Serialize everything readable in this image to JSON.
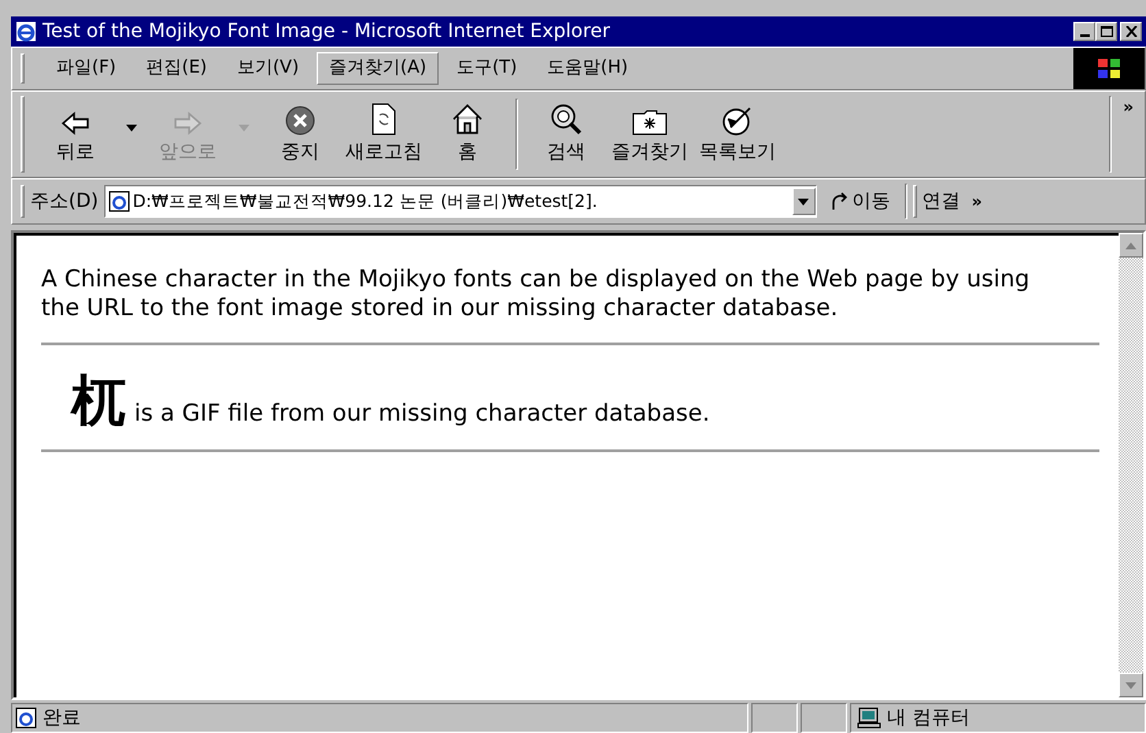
{
  "window": {
    "title": "Test of the Mojikyo Font Image - Microsoft Internet Explorer"
  },
  "menu": [
    {
      "label": "파일(F)",
      "selected": false
    },
    {
      "label": "편집(E)",
      "selected": false
    },
    {
      "label": "보기(V)",
      "selected": false
    },
    {
      "label": "즐겨찾기(A)",
      "selected": true
    },
    {
      "label": "도구(T)",
      "selected": false
    },
    {
      "label": "도움말(H)",
      "selected": false
    }
  ],
  "toolbar": {
    "buttons": [
      {
        "kind": "back",
        "label": "뒤로",
        "disabled": false,
        "dropdown": true
      },
      {
        "kind": "forward",
        "label": "앞으로",
        "disabled": true,
        "dropdown": true
      },
      {
        "kind": "stop",
        "label": "중지",
        "disabled": false,
        "dropdown": false
      },
      {
        "kind": "refresh",
        "label": "새로고침",
        "disabled": false,
        "dropdown": false
      },
      {
        "kind": "home",
        "label": "홈",
        "disabled": false,
        "dropdown": false
      },
      {
        "kind": "search",
        "label": "검색",
        "disabled": false,
        "dropdown": false
      },
      {
        "kind": "favorites",
        "label": "즐겨찾기",
        "disabled": false,
        "dropdown": false
      },
      {
        "kind": "history",
        "label": "목록보기",
        "disabled": false,
        "dropdown": false
      }
    ],
    "more": "»"
  },
  "address_bar": {
    "label": "주소(D)",
    "value": "D:₩프로젝트₩불교전적₩99.12 논문 (버클리)₩etest[2].",
    "go": "이동",
    "links": "연결",
    "more": "»"
  },
  "content": {
    "paragraph": "A Chinese character in the Mojikyo fonts can be displayed on the Web page by using the URL to the font image stored in our missing character database.",
    "glyph": "杌",
    "caption": "is a GIF file from our missing character database."
  },
  "status_bar": {
    "text": "완료",
    "zone": "내 컴퓨터"
  }
}
